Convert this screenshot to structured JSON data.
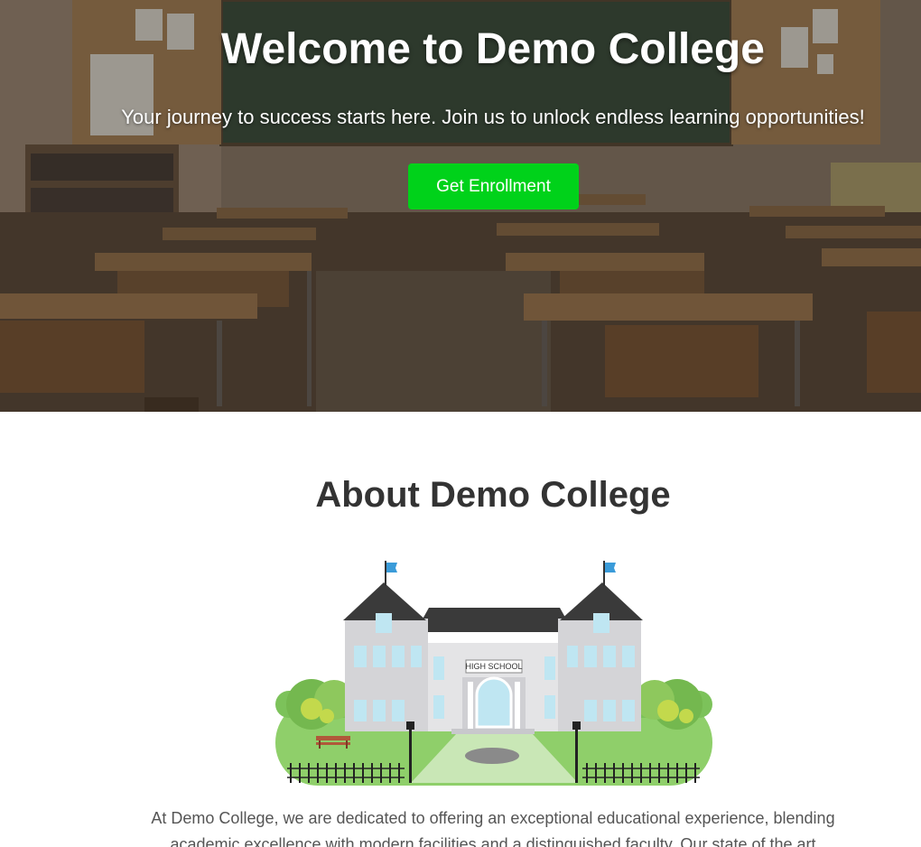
{
  "hero": {
    "title": "Welcome to Demo College",
    "subtitle": "Your journey to success starts here. Join us to unlock endless learning opportunities!",
    "cta_label": "Get Enrollment",
    "cta_color": "#00d21a"
  },
  "about": {
    "title": "About Demo College",
    "illustration_sign": "HIGH SCHOOL",
    "paragraph": "At Demo College, we are dedicated to offering an exceptional educational experience, blending academic excellence with modern facilities and a distinguished faculty. Our state of the art"
  },
  "colors": {
    "text_dark": "#333333",
    "text_body": "#555555",
    "roof": "#3a3a3a",
    "flag": "#3a9bd9"
  }
}
